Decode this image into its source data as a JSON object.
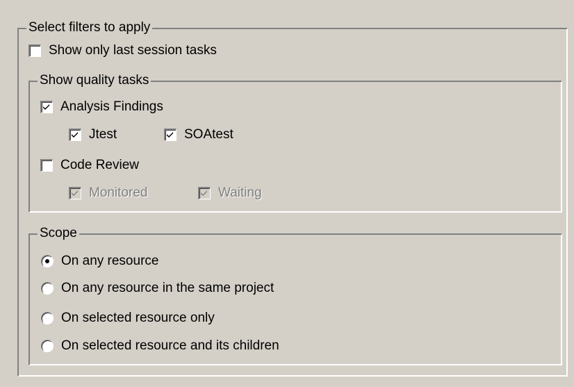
{
  "filters": {
    "title": "Select filters to apply",
    "last_session": {
      "label": "Show only last session tasks",
      "checked": false
    },
    "quality": {
      "title": "Show quality tasks",
      "analysis": {
        "label": "Analysis Findings",
        "checked": true
      },
      "jtest": {
        "label": "Jtest",
        "checked": true
      },
      "soatest": {
        "label": "SOAtest",
        "checked": true
      },
      "code_review": {
        "label": "Code Review",
        "checked": false
      },
      "monitored": {
        "label": "Monitored",
        "checked": true,
        "enabled": false
      },
      "waiting": {
        "label": "Waiting",
        "checked": true,
        "enabled": false
      }
    },
    "scope": {
      "title": "Scope",
      "options": [
        {
          "label": "On any resource",
          "selected": true
        },
        {
          "label": "On any resource in the same project",
          "selected": false
        },
        {
          "label": "On selected resource only",
          "selected": false
        },
        {
          "label": "On selected resource and its children",
          "selected": false
        }
      ]
    }
  }
}
